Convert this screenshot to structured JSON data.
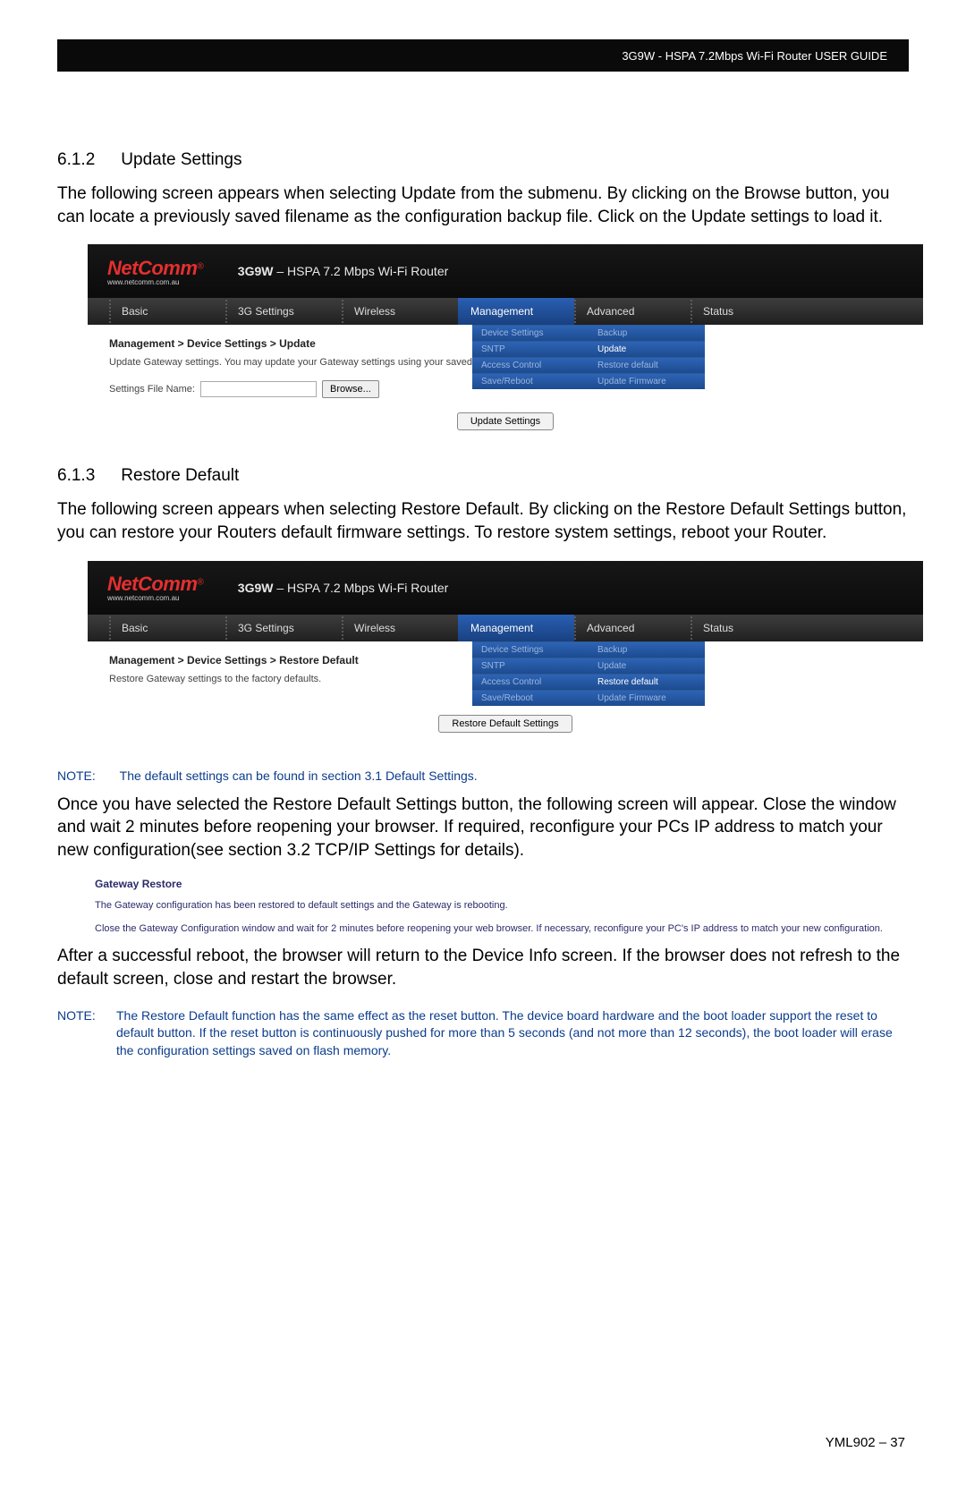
{
  "header": {
    "title": "3G9W - HSPA 7.2Mbps Wi-Fi Router USER GUIDE"
  },
  "sec612": {
    "num": "6.1.2",
    "name": "Update Settings",
    "para": "The following screen appears when selecting Update from the submenu. By clicking on the Browse button, you can locate a previously saved filename as the configuration backup file. Click on the Update settings to load it."
  },
  "sec613": {
    "num": "6.1.3",
    "name": "Restore Default",
    "para": "The following screen appears when selecting Restore Default. By clicking on the Restore Default Settings button, you can restore your Routers default firmware settings. To restore system settings, reboot your Router."
  },
  "shot_common": {
    "logo": "NetComm",
    "logo_sub": "www.netcomm.com.au",
    "title_strong": "3G9W",
    "title_rest": " – HSPA 7.2 Mbps Wi-Fi Router",
    "nav": [
      "Basic",
      "3G Settings",
      "Wireless",
      "Management",
      "Advanced",
      "Status"
    ],
    "dd_left": [
      "Device Settings",
      "SNTP",
      "Access Control",
      "Save/Reboot"
    ],
    "dd_right": [
      "Backup",
      "Update",
      "Restore default",
      "Update Firmware"
    ]
  },
  "shot1": {
    "breadcrumb": "Management > Device Settings > Update",
    "desc": "Update Gateway settings. You may update your Gateway settings using your saved fi",
    "field_label": "Settings File Name:",
    "browse": "Browse...",
    "button": "Update Settings",
    "dd_hi_left": null,
    "dd_hi_right": "Update"
  },
  "shot2": {
    "breadcrumb": "Management > Device Settings > Restore Default",
    "desc": "Restore Gateway settings to the factory defaults.",
    "button": "Restore Default Settings",
    "dd_hi_right": "Restore default"
  },
  "note1": {
    "label": "NOTE:",
    "text": "The default settings can be found in section 3.1 Default Settings."
  },
  "para2": "Once you have selected the Restore Default Settings button, the following screen will appear. Close the window and wait 2 minutes before reopening your browser. If required, reconfigure your PCs IP address to match your new configuration(see section 3.2 TCP/IP Settings for details).",
  "gw": {
    "title": "Gateway Restore",
    "l1": "The Gateway configuration has been restored to default settings and the Gateway is rebooting.",
    "l2": "Close the Gateway Configuration window and wait for 2 minutes before reopening your web browser. If necessary, reconfigure your PC's IP address to match your new configuration."
  },
  "para3": "After a successful reboot, the browser will return to the Device Info screen.  If the browser does not refresh to the default screen, close and restart the browser.",
  "note2": {
    "label": "NOTE:",
    "text": "The Restore Default function has the same effect as the reset button.  The device board hardware and the boot loader support the reset to default button.  If the reset button is continuously pushed for more than 5 seconds (and not more than 12 seconds), the boot loader will erase the configuration settings saved on flash memory."
  },
  "footer": "YML902 – 37"
}
